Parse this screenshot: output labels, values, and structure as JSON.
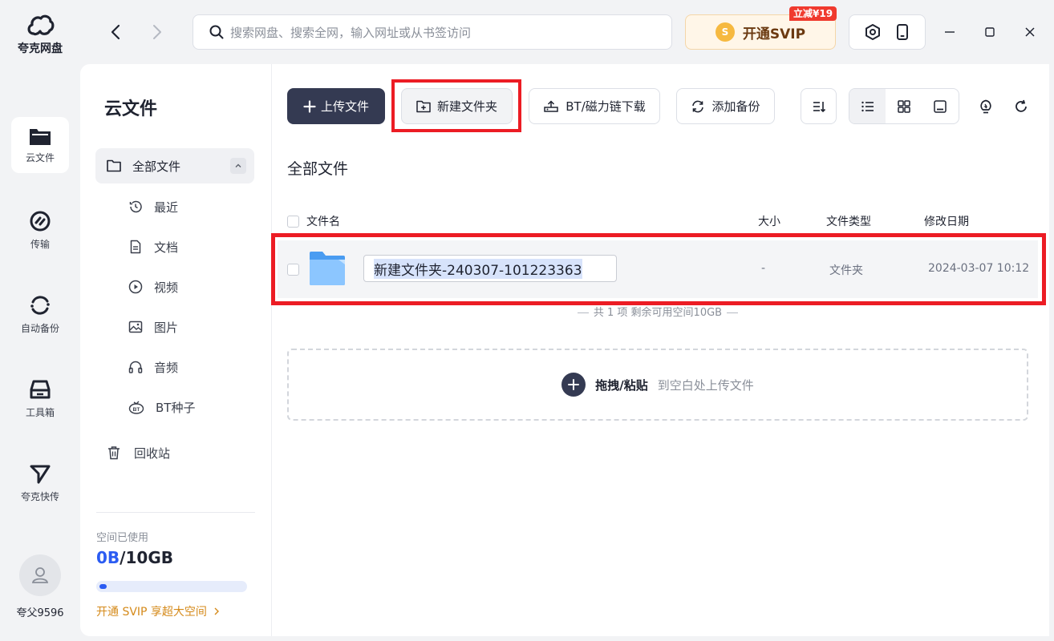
{
  "app": {
    "name": "夸克网盘"
  },
  "rail": {
    "items": [
      {
        "label": "云文件",
        "icon": "folder-icon",
        "active": true
      },
      {
        "label": "传输",
        "icon": "transfer-icon"
      },
      {
        "label": "自动备份",
        "icon": "auto-backup-icon"
      },
      {
        "label": "工具箱",
        "icon": "toolbox-icon"
      },
      {
        "label": "夸克快传",
        "icon": "quick-send-icon"
      }
    ],
    "username": "夸父9596"
  },
  "titlebar": {
    "search_placeholder": "搜索网盘、搜索全网，输入网址或从书签访问",
    "svip_label": "开通SVIP",
    "svip_coin": "S",
    "svip_badge": "立减¥19"
  },
  "sidebar": {
    "title": "云文件",
    "all_files": "全部文件",
    "sub_items": [
      {
        "label": "最近",
        "icon": "recent-clock-icon"
      },
      {
        "label": "文档",
        "icon": "document-icon"
      },
      {
        "label": "视频",
        "icon": "video-icon"
      },
      {
        "label": "图片",
        "icon": "image-icon"
      },
      {
        "label": "音频",
        "icon": "headphones-icon"
      },
      {
        "label": "BT种子",
        "icon": "bt-seed-icon"
      }
    ],
    "trash": "回收站",
    "storage_label": "空间已使用",
    "storage_used": "0B",
    "storage_sep": "/",
    "storage_total": "10GB",
    "storage_fraction": 0.05,
    "upsell": "开通 SVIP 享超大空间"
  },
  "toolbar": {
    "upload": "上传文件",
    "new_folder": "新建文件夹",
    "bt_download": "BT/磁力链下载",
    "add_backup": "添加备份"
  },
  "breadcrumb": "全部文件",
  "table": {
    "headers": {
      "name": "文件名",
      "size": "大小",
      "type": "文件类型",
      "modified": "修改日期"
    },
    "rows": [
      {
        "name": "新建文件夹-240307-101223363",
        "size": "-",
        "type": "文件夹",
        "modified": "2024-03-07 10:12"
      }
    ],
    "summary": "共 1 项 剩余可用空间10GB"
  },
  "dropzone": {
    "main": "拖拽/粘贴",
    "sub": "到空白处上传文件"
  },
  "colors": {
    "accent": "#343a52",
    "highlight": "#ec1c24",
    "storage": "#2b5cf2",
    "svip": "#d58a1a"
  }
}
